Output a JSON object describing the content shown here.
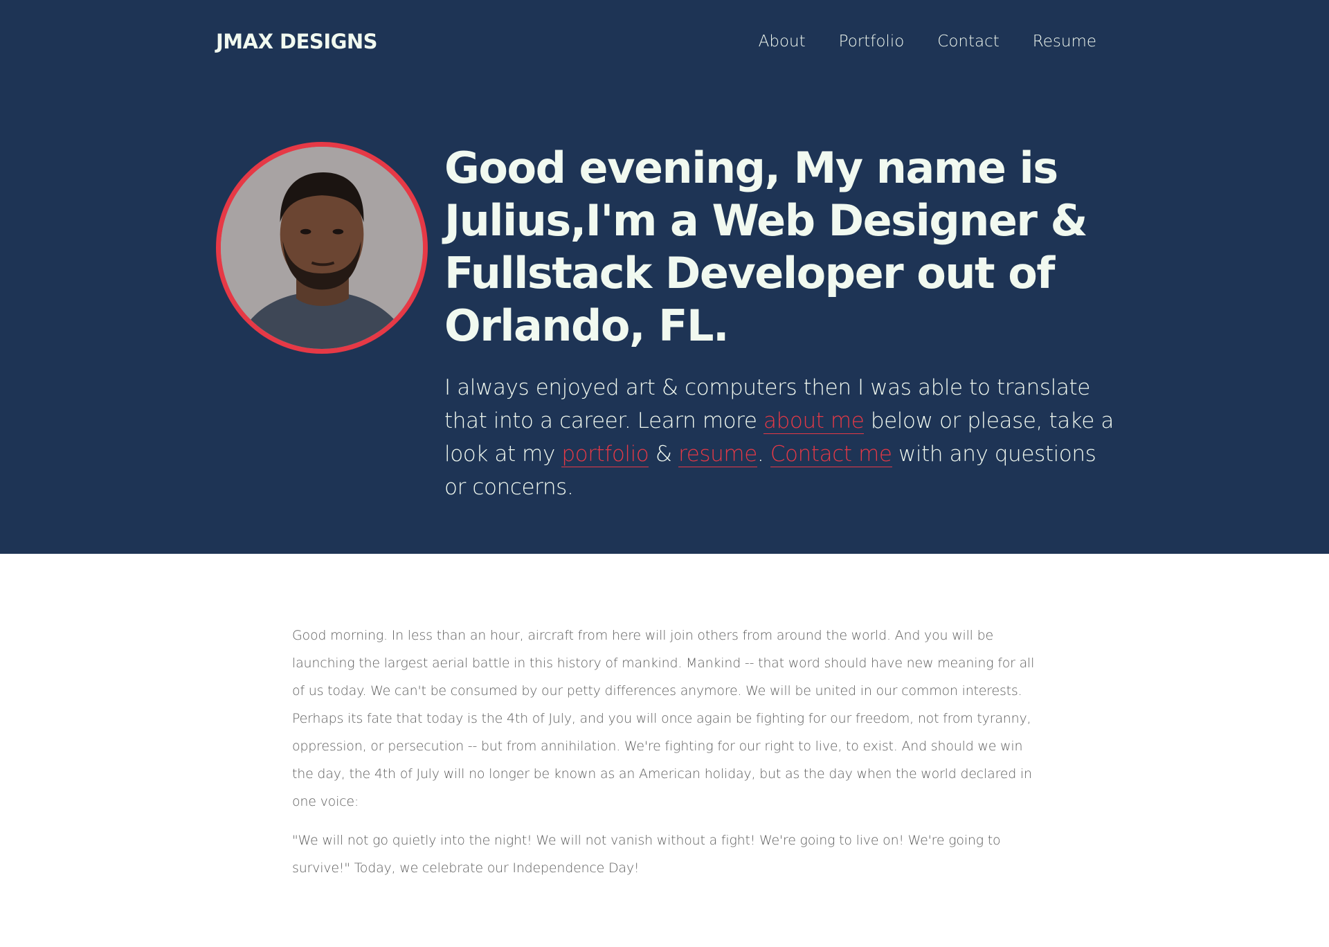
{
  "nav": {
    "brand": "JMAX DESIGNS",
    "links": [
      "About",
      "Portfolio",
      "Contact",
      "Resume"
    ]
  },
  "hero": {
    "headline": "Good evening, My name is Julius,I'm a Web Designer & Fullstack Developer out of Orlando, FL.",
    "intro": {
      "part1": "I always enjoyed art & computers then I was able to translate that into a career. Learn more ",
      "link_about": "about me",
      "part2": " below or please, take a look at my ",
      "link_portfolio": "portfolio",
      "part3": " & ",
      "link_resume": "resume",
      "part4": ". ",
      "link_contact": "Contact me",
      "part5": " with any questions or concerns."
    },
    "avatar_icon": "profile-photo"
  },
  "article": {
    "paragraph1": "Good morning. In less than an hour, aircraft from here will join others from around the world. And you will be launching the largest aerial battle in this history of mankind. Mankind -- that word should have new meaning for all of us today. We can't be consumed by our petty differences anymore. We will be united in our common interests. Perhaps its fate that today is the 4th of July, and you will once again be fighting for our freedom, not from tyranny, oppression, or persecution -- but from annihilation. We're fighting for our right to live, to exist. And should we win the day, the 4th of July will no longer be known as an American holiday, but as the day when the world declared in one voice:",
    "paragraph2": "\"We will not go quietly into the night! We will not vanish without a fight! We're going to live on! We're going to survive!\" Today, we celebrate our Independence Day!"
  },
  "colors": {
    "hero_bg": "#1e3455",
    "accent": "#e63946",
    "hero_text": "#f1f9f0",
    "body_text": "#5d5d5d"
  }
}
